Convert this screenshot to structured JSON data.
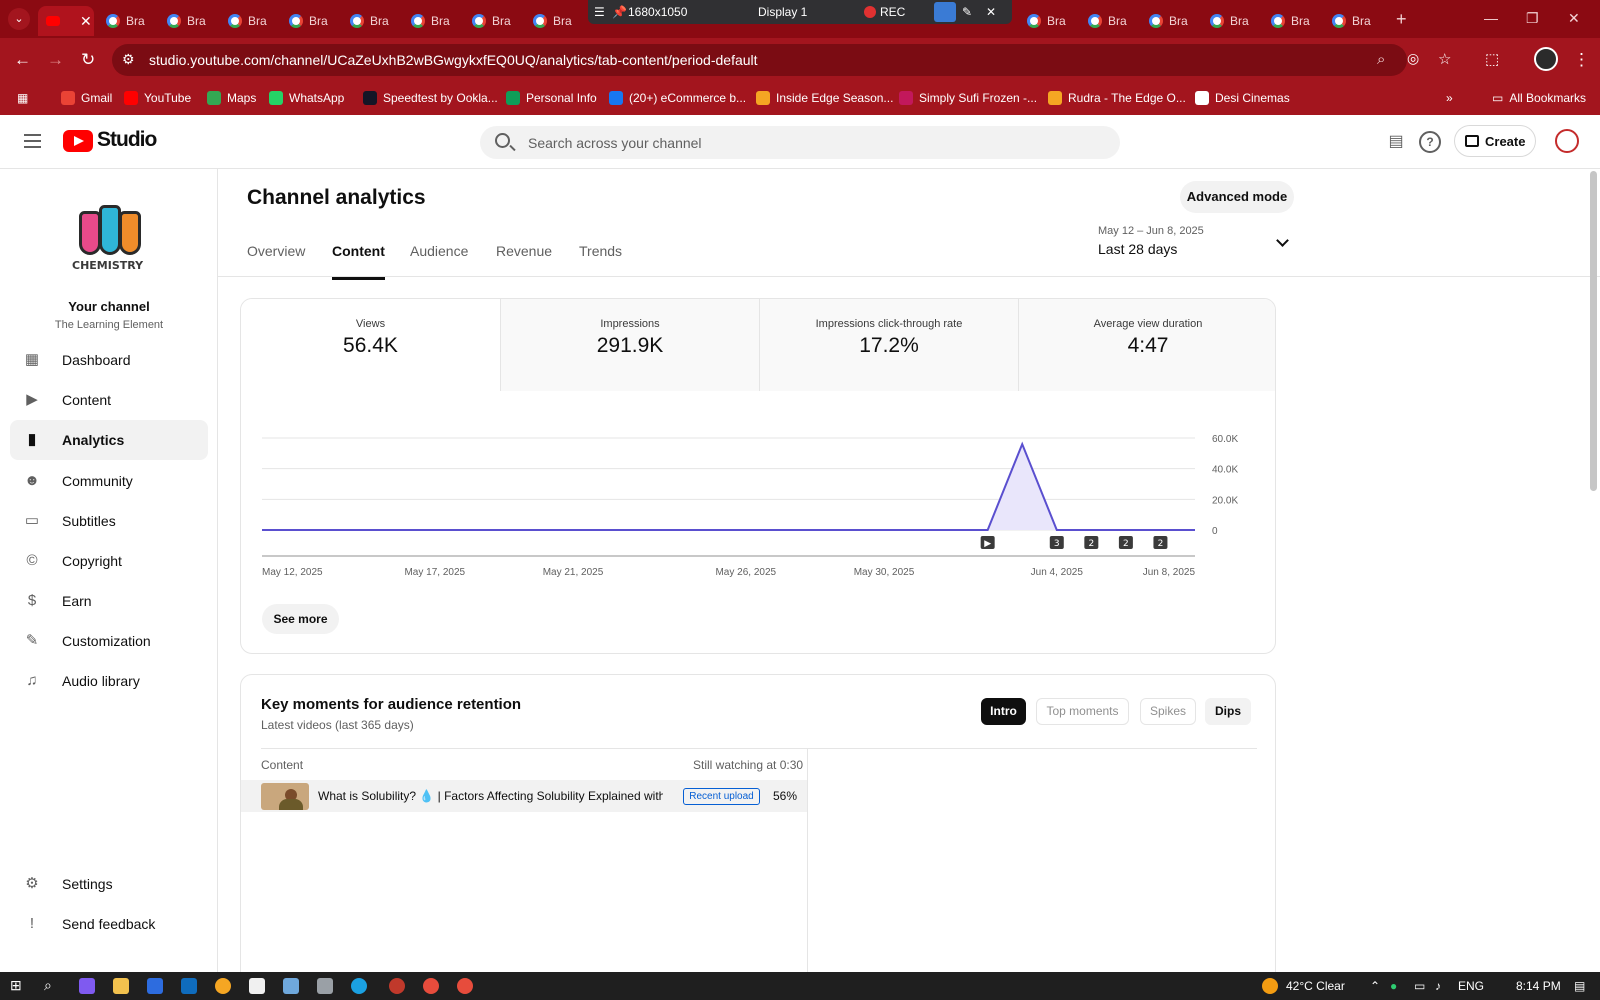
{
  "browser": {
    "active_tab_close": "✕",
    "tab_label": "Bra",
    "new_tab": "+",
    "url": "studio.youtube.com/channel/UCaZeUxhB2wBGwgykxfEQ0UQ/analytics/tab-content/period-default",
    "bookmarks": [
      {
        "label": "Gmail",
        "color": "#ea4335"
      },
      {
        "label": "YouTube",
        "color": "#ff0000"
      },
      {
        "label": "Maps",
        "color": "#34a853"
      },
      {
        "label": "WhatsApp",
        "color": "#25d366"
      },
      {
        "label": "Speedtest by Ookla...",
        "color": "#141526"
      },
      {
        "label": "Personal Info",
        "color": "#0f9d58"
      },
      {
        "label": "(20+) eCommerce b...",
        "color": "#1877f2"
      },
      {
        "label": "Inside Edge Season...",
        "color": "#f5a623"
      },
      {
        "label": "Simply Sufi Frozen -...",
        "color": "#c2185b"
      },
      {
        "label": "Rudra - The Edge O...",
        "color": "#f5a623"
      },
      {
        "label": "Desi Cinemas",
        "color": "#ffffff"
      }
    ],
    "all_bookmarks": "All Bookmarks"
  },
  "recorder": {
    "resolution": "1680x1050",
    "display": "Display 1",
    "rec": "REC"
  },
  "studio": {
    "logo_text": "Studio",
    "search_placeholder": "Search across your channel",
    "create_label": "Create"
  },
  "sidebar": {
    "channel_logo_word": "CHEMISTRY",
    "your_channel": "Your channel",
    "channel_name": "The Learning Element",
    "items": [
      {
        "label": "Dashboard",
        "icon": "dashboard-icon",
        "glyph": "▦"
      },
      {
        "label": "Content",
        "icon": "content-icon",
        "glyph": "▶"
      },
      {
        "label": "Analytics",
        "icon": "analytics-icon",
        "glyph": "▮"
      },
      {
        "label": "Community",
        "icon": "community-icon",
        "glyph": "☻"
      },
      {
        "label": "Subtitles",
        "icon": "subtitles-icon",
        "glyph": "▭"
      },
      {
        "label": "Copyright",
        "icon": "copyright-icon",
        "glyph": "©"
      },
      {
        "label": "Earn",
        "icon": "earn-icon",
        "glyph": "$"
      },
      {
        "label": "Customization",
        "icon": "customization-icon",
        "glyph": "✎"
      },
      {
        "label": "Audio library",
        "icon": "audio-library-icon",
        "glyph": "♫"
      }
    ],
    "bottom_items": [
      {
        "label": "Settings",
        "icon": "settings-icon",
        "glyph": "⚙"
      },
      {
        "label": "Send feedback",
        "icon": "feedback-icon",
        "glyph": "!"
      }
    ]
  },
  "main": {
    "title": "Channel analytics",
    "advanced_mode": "Advanced mode",
    "tabs": [
      "Overview",
      "Content",
      "Audience",
      "Revenue",
      "Trends"
    ],
    "active_tab": "Content",
    "date_range_sub": "May 12 – Jun 8, 2025",
    "date_range": "Last 28 days",
    "metrics": [
      {
        "label": "Views",
        "value": "56.4K"
      },
      {
        "label": "Impressions",
        "value": "291.9K"
      },
      {
        "label": "Impressions click-through rate",
        "value": "17.2%"
      },
      {
        "label": "Average view duration",
        "value": "4:47"
      }
    ],
    "see_more": "See more"
  },
  "chart_data": {
    "type": "area",
    "x": [
      "May 12, 2025",
      "May 13",
      "May 14",
      "May 15",
      "May 16",
      "May 17, 2025",
      "May 18",
      "May 19",
      "May 20",
      "May 21, 2025",
      "May 22",
      "May 23",
      "May 24",
      "May 25",
      "May 26, 2025",
      "May 27",
      "May 28",
      "May 29",
      "May 30, 2025",
      "May 31",
      "Jun 1",
      "Jun 2",
      "Jun 3",
      "Jun 4, 2025",
      "Jun 5",
      "Jun 6",
      "Jun 7",
      "Jun 8, 2025"
    ],
    "x_tick_labels": [
      "May 12, 2025",
      "May 17, 2025",
      "May 21, 2025",
      "May 26, 2025",
      "May 30, 2025",
      "Jun 4, 2025",
      "Jun 8, 2025"
    ],
    "series": [
      {
        "values": [
          0,
          0,
          0,
          0,
          0,
          0,
          0,
          0,
          0,
          0,
          0,
          0,
          0,
          0,
          0,
          0,
          0,
          0,
          0,
          0,
          0,
          0,
          56000,
          0,
          0,
          0,
          0,
          0
        ]
      }
    ],
    "y_ticks": [
      "0",
      "20.0K",
      "40.0K",
      "60.0K"
    ],
    "ylim": [
      0,
      60000
    ],
    "grid": true,
    "line_color": "#5a4fcf",
    "fill_color": "#e9e6fb",
    "markers": [
      {
        "x": "Jun 2",
        "label": "▶"
      },
      {
        "x": "Jun 4, 2025",
        "label": "3"
      },
      {
        "x": "Jun 5",
        "label": "2"
      },
      {
        "x": "Jun 6",
        "label": "2"
      },
      {
        "x": "Jun 7",
        "label": "2"
      }
    ]
  },
  "key_moments": {
    "title": "Key moments for audience retention",
    "subtitle": "Latest videos (last 365 days)",
    "chips": [
      "Intro",
      "Top moments",
      "Spikes",
      "Dips"
    ],
    "col_content": "Content",
    "col_still": "Still watching at 0:30",
    "row": {
      "title": "What is Solubility? 💧 | Factors Affecting Solubility Explained with Exa...",
      "badge": "Recent upload",
      "percent": "56%"
    }
  },
  "taskbar": {
    "weather": "42°C  Clear",
    "lang": "ENG",
    "time": "8:14 PM"
  }
}
